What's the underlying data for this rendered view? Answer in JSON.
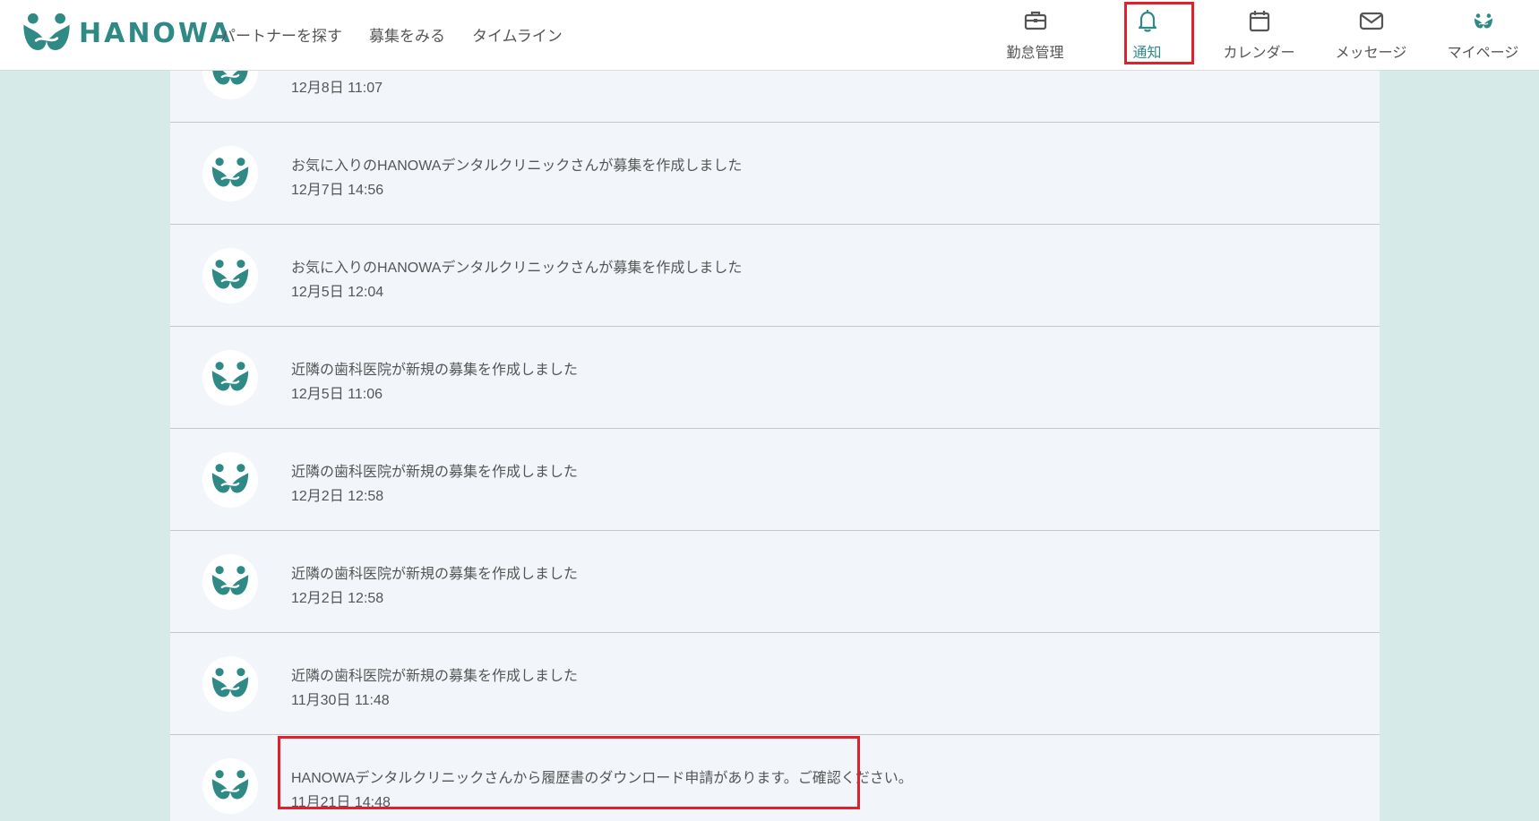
{
  "header": {
    "logo_text": "HANOWA",
    "top_links": [
      "パートナーを探す",
      "募集をみる",
      "タイムライン"
    ],
    "nav": [
      {
        "label": "勤怠管理",
        "icon": "briefcase-icon"
      },
      {
        "label": "通知",
        "icon": "bell-icon",
        "active": true
      },
      {
        "label": "カレンダー",
        "icon": "calendar-icon"
      },
      {
        "label": "メッセージ",
        "icon": "envelope-icon"
      },
      {
        "label": "マイページ",
        "icon": "hanowa-logo-icon"
      }
    ]
  },
  "notifications": [
    {
      "message": "",
      "time": "12月8日 11:07"
    },
    {
      "message": "お気に入りのHANOWAデンタルクリニックさんが募集を作成しました",
      "time": "12月7日 14:56"
    },
    {
      "message": "お気に入りのHANOWAデンタルクリニックさんが募集を作成しました",
      "time": "12月5日 12:04"
    },
    {
      "message": "近隣の歯科医院が新規の募集を作成しました",
      "time": "12月5日 11:06"
    },
    {
      "message": "近隣の歯科医院が新規の募集を作成しました",
      "time": "12月2日 12:58"
    },
    {
      "message": "近隣の歯科医院が新規の募集を作成しました",
      "time": "12月2日 12:58"
    },
    {
      "message": "近隣の歯科医院が新規の募集を作成しました",
      "time": "11月30日 11:48"
    },
    {
      "message": "HANOWAデンタルクリニックさんから履歴書のダウンロード申請があります。ご確認ください。",
      "time": "11月21日 14:48"
    }
  ],
  "colors": {
    "brand": "#2f8a86",
    "background": "#d6ebe8",
    "panel": "#f2f6fa",
    "highlight": "#e0202a"
  }
}
